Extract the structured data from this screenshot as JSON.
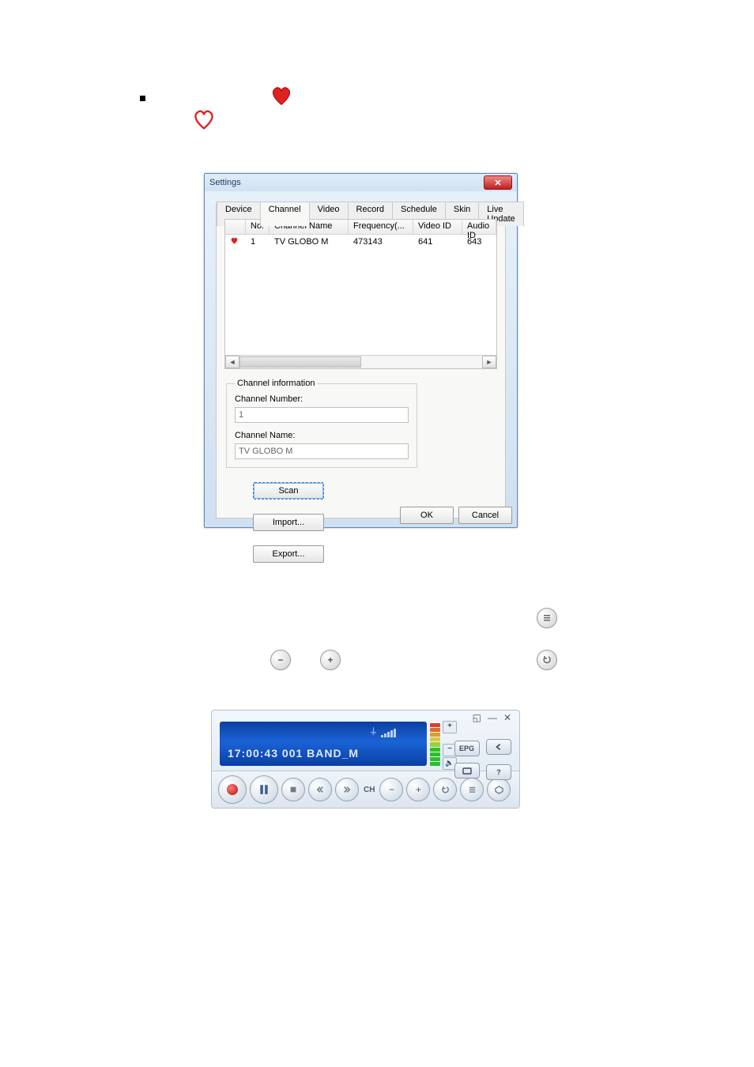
{
  "settings": {
    "title": "Settings",
    "tabs": [
      "Device",
      "Channel",
      "Video",
      "Record",
      "Schedule",
      "Skin",
      "Live Update"
    ],
    "active_tab_index": 1,
    "columns": [
      "No.",
      "Channel Name",
      "Frequency(...",
      "Video ID",
      "Audio ID"
    ],
    "rows": [
      {
        "fav": true,
        "no": "1",
        "name": "TV GLOBO M",
        "freq": "473143",
        "vid": "641",
        "aud": "643"
      }
    ],
    "channel_info": {
      "legend": "Channel information",
      "number_label": "Channel Number:",
      "number_value": "1",
      "name_label": "Channel Name:",
      "name_value": "TV GLOBO M"
    },
    "scan": "Scan",
    "import": "Import...",
    "export": "Export...",
    "ok": "OK",
    "cancel": "Cancel"
  },
  "player": {
    "display": "17:00:43 001 BAND_M",
    "ch_label": "CH",
    "epg": "EPG"
  }
}
